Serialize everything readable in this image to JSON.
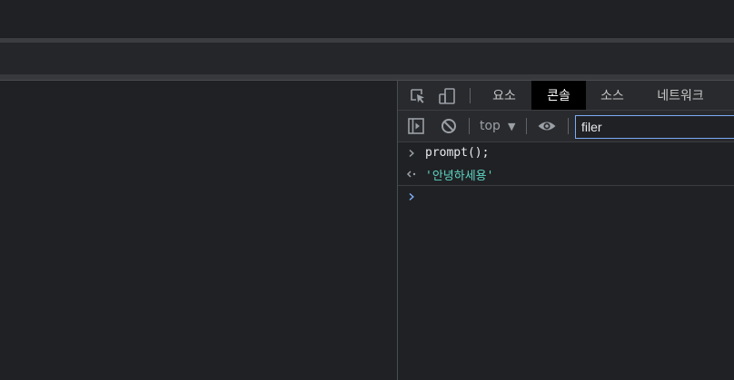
{
  "devtools": {
    "tabs": [
      {
        "label": "요소",
        "active": false
      },
      {
        "label": "콘솔",
        "active": true
      },
      {
        "label": "소스",
        "active": false
      },
      {
        "label": "네트워크",
        "active": false
      }
    ],
    "toolbar": {
      "context": "top",
      "filter_value": "filer"
    },
    "console": {
      "entries": [
        {
          "type": "input",
          "text": "prompt();"
        },
        {
          "type": "result",
          "text": "'안녕하세용'"
        }
      ]
    },
    "icons": {
      "inspect": "inspect-element-icon",
      "device": "device-toggle-icon",
      "sidebar": "console-sidebar-icon",
      "clear": "clear-console-icon",
      "eye": "live-expression-eye-icon",
      "caret": "dropdown-caret-icon",
      "input_chevron": "input-chevron-icon",
      "result_arrow": "result-arrow-icon",
      "prompt_chevron": "prompt-chevron-icon"
    },
    "colors": {
      "active_tab_bg": "#000000",
      "filter_border": "#7cacf8",
      "result_text": "#5cd5c4",
      "prompt": "#7cacf8"
    }
  }
}
